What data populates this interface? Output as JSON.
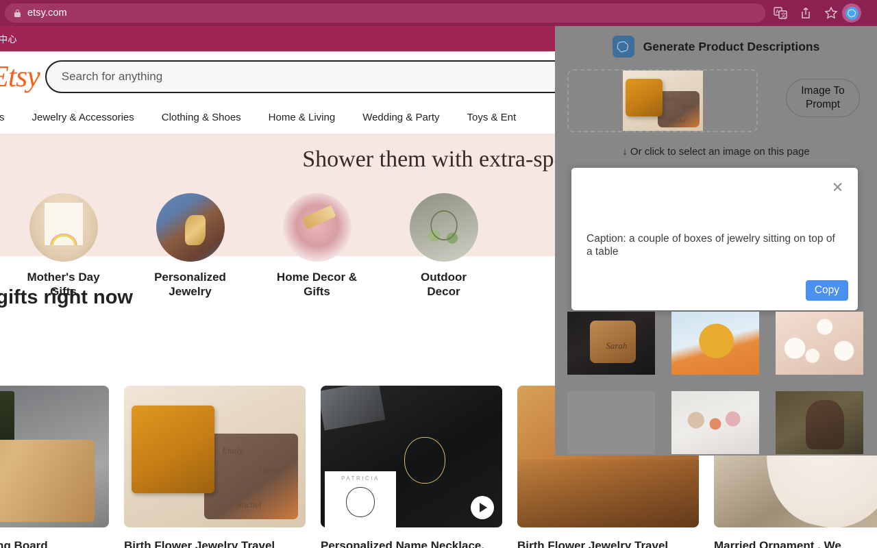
{
  "browser": {
    "url": "etsy.com",
    "lock_icon": "lock-icon",
    "toolbar_icons": [
      "translate-icon",
      "share-icon",
      "bookmark-star-icon",
      "extension-icon"
    ]
  },
  "etsy": {
    "promo_text": "中心",
    "logo": "Etsy",
    "search": {
      "placeholder": "Search for anything",
      "value": ""
    },
    "nav": [
      "avorites",
      "Jewelry & Accessories",
      "Clothing & Shoes",
      "Home & Living",
      "Wedding & Party",
      "Toys & Ent"
    ],
    "hero_title": "Shower them with extra-spec",
    "categories": [
      {
        "label": "Mother's Day\nGifts",
        "art": "art-kidart"
      },
      {
        "label": "Personalized\nJewelry",
        "art": "art-bracelet"
      },
      {
        "label": "Home Decor &\nGifts",
        "art": "art-plates"
      },
      {
        "label": "Outdoor\nDecor",
        "art": "art-outdoor"
      }
    ],
    "section_title": "ular gifts right now",
    "products": [
      {
        "title": "nalized Cutting Board",
        "art": "art-board",
        "video": false
      },
      {
        "title": "Birth Flower Jewelry Travel",
        "art": "art-jewelbox",
        "video": false
      },
      {
        "title": "Personalized Name Necklace,",
        "art": "art-necklace",
        "video": true
      },
      {
        "title": "Birth Flower Jewelry Travel",
        "art": "art-wallet",
        "video": false
      },
      {
        "title": "Married Ornament , We",
        "art": "art-ornament",
        "video": false
      }
    ]
  },
  "extension": {
    "title": "Generate Product Descriptions",
    "logo_icon": "chatgpt-swirl-icon",
    "image_to_prompt_line1": "Image To",
    "image_to_prompt_line2": "Prompt",
    "hint": "↓ Or click to select an image on this page",
    "dropzone_thumb_art": "art-jewelbox",
    "caption_dialog": {
      "close_icon": "close-icon",
      "text": "Caption: a couple of boxes of jewelry sitting on top of a table",
      "copy_label": "Copy",
      "copy_color": "#4a90f0"
    },
    "grid": [
      {
        "art": "art-sarahbox",
        "name": "Sarah"
      },
      {
        "art": "art-sticker",
        "name": ""
      },
      {
        "art": "art-candles",
        "name": ""
      },
      {
        "art": "art-wallets",
        "name": ""
      },
      {
        "art": "art-blocks",
        "name": ""
      },
      {
        "art": "art-hand",
        "name": ""
      }
    ]
  },
  "colors": {
    "browser_bar": "#8c2252",
    "etsy_promo": "#a02454",
    "etsy_orange": "#f1641e",
    "hero_bg": "#f7e7e3",
    "panel_bg": "#878787",
    "accent_blue": "#4a90f0"
  }
}
